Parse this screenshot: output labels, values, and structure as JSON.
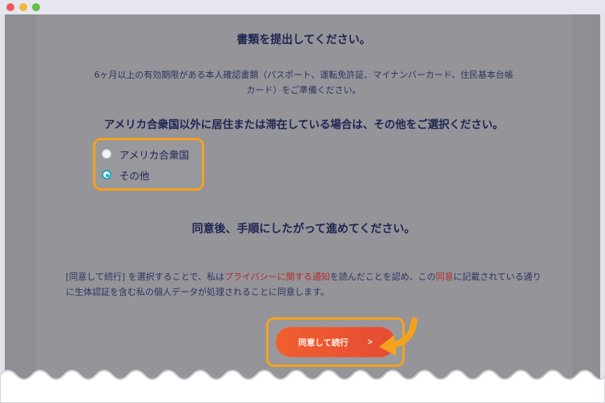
{
  "window": {
    "title": ""
  },
  "screen": {
    "title": "書類を提出してください。",
    "notice": "6ヶ月以上の有効期限がある本人確認書類（パスポート、運転免許証、マイナンバーカード、住民基本台帳カード）をご準備ください。",
    "question": "アメリカ合衆国以外に居住または滞在している場合は、その他をご選択ください。",
    "options": [
      {
        "label": "アメリカ合衆国",
        "selected": false
      },
      {
        "label": "その他",
        "selected": true
      }
    ],
    "continue_heading": "同意後、手順にしたがって進めてください。",
    "consent": {
      "prefix": "[同意して続行] を選択することで、私は",
      "link1": "プライバシーに関する通知",
      "middle": "を読んだことを認め、この",
      "link2": "同意",
      "suffix": "に記載されている通りに生体認証を含む私の個人データが処理されることに同意します。"
    },
    "button": {
      "label": "同意して続行",
      "arrow": ">"
    }
  },
  "colors": {
    "accent": "#f4a21e",
    "button_start": "#f05f2e",
    "button_end": "#e64b34",
    "radio": "#20a8c4",
    "link": "#b32b2b"
  },
  "icons": {
    "close": "window-close-icon",
    "minimize": "window-minimize-icon",
    "zoom": "window-zoom-icon",
    "callout": "curved-arrow-icon"
  }
}
